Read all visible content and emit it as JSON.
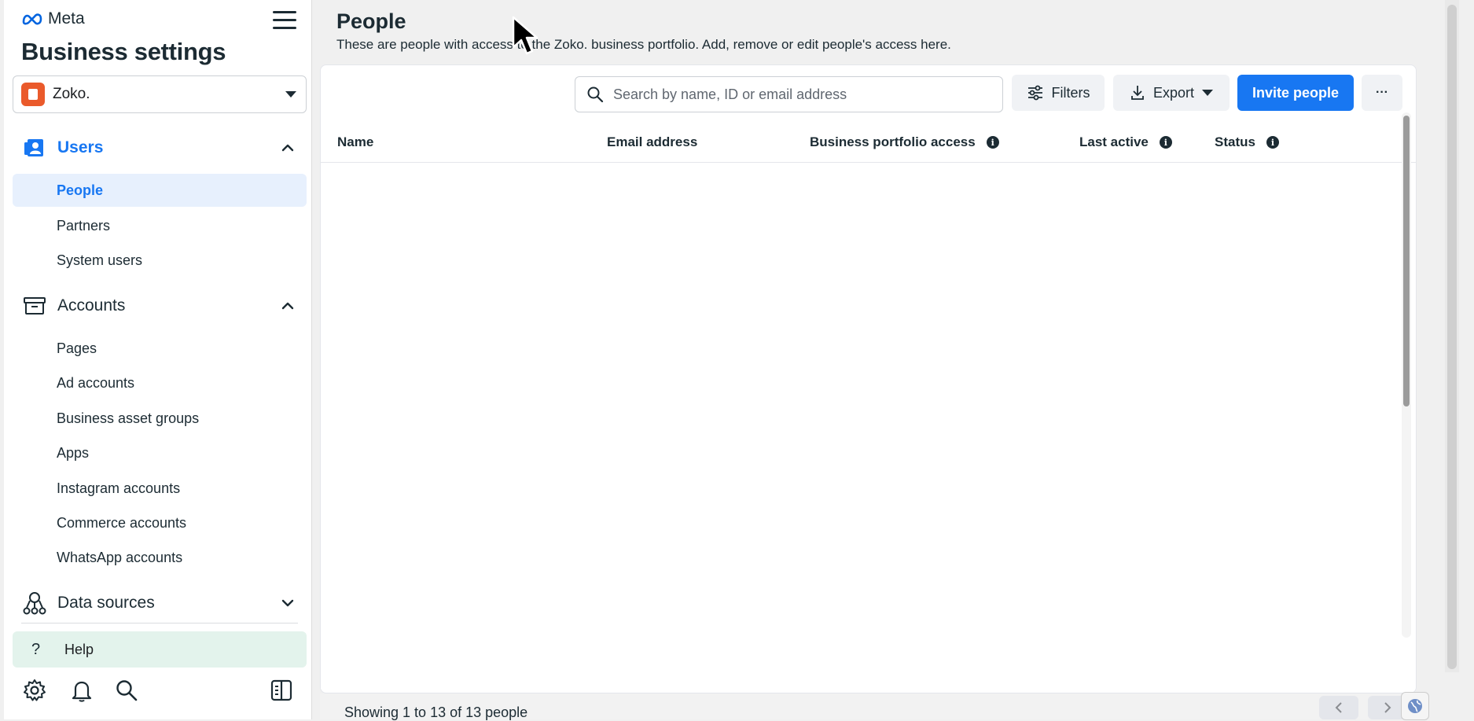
{
  "sidebar": {
    "brand": "Meta",
    "title": "Business settings",
    "portfolio_name": "Zoko.",
    "sections": {
      "users": "Users",
      "accounts": "Accounts",
      "data_sources": "Data sources"
    },
    "users_items": [
      "People",
      "Partners",
      "System users"
    ],
    "accounts_items": [
      "Pages",
      "Ad accounts",
      "Business asset groups",
      "Apps",
      "Instagram accounts",
      "Commerce accounts",
      "WhatsApp accounts"
    ],
    "help_label": "Help"
  },
  "main": {
    "title": "People",
    "description": "These are people with access to the Zoko. business portfolio. Add, remove or edit people's access here.",
    "search_placeholder": "Search by name, ID or email address",
    "filters_label": "Filters",
    "export_label": "Export",
    "invite_label": "Invite people",
    "more_label": "···",
    "columns": [
      "Name",
      "Email address",
      "Business portfolio access",
      "Last active",
      "Status"
    ],
    "footer_text": "Showing 1 to 13 of 13 people"
  },
  "colors": {
    "accent": "#1877f2",
    "help_bg": "#e3f3ec",
    "active_item_bg": "#e7f0fd"
  }
}
